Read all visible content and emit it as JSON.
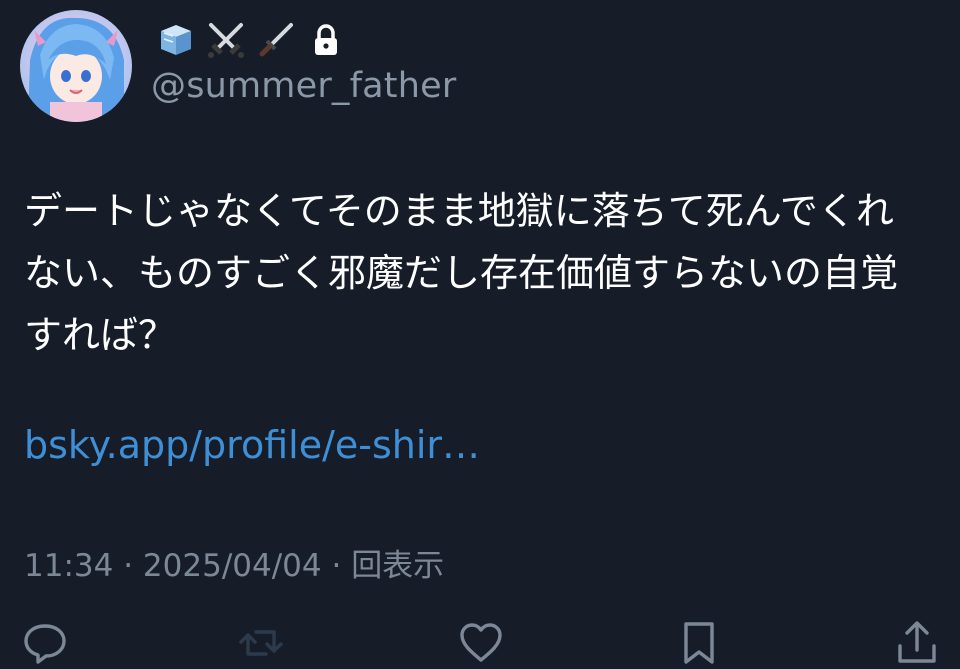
{
  "profile": {
    "handle": "@summer_father",
    "badges": [
      "ice-cube-icon",
      "crossed-swords-icon",
      "dagger-icon",
      "lock-icon"
    ]
  },
  "tweet": {
    "text": "デートじゃなくてそのまま地獄に落ちて死んでくれ\nない、ものすごく邪魔だし存在価値すらないの自覚\nすれば？",
    "link": "bsky.app/profile/e-shir…",
    "time": "11:34",
    "date": "2025/04/04",
    "separator": "·",
    "views_label": "回表示"
  },
  "actions": [
    "reply-icon",
    "retweet-icon",
    "like-icon",
    "bookmark-icon",
    "share-icon"
  ],
  "colors": {
    "background": "#161d28",
    "text": "#ffffff",
    "secondary": "#8b98a8",
    "link": "#3f8fd6"
  }
}
